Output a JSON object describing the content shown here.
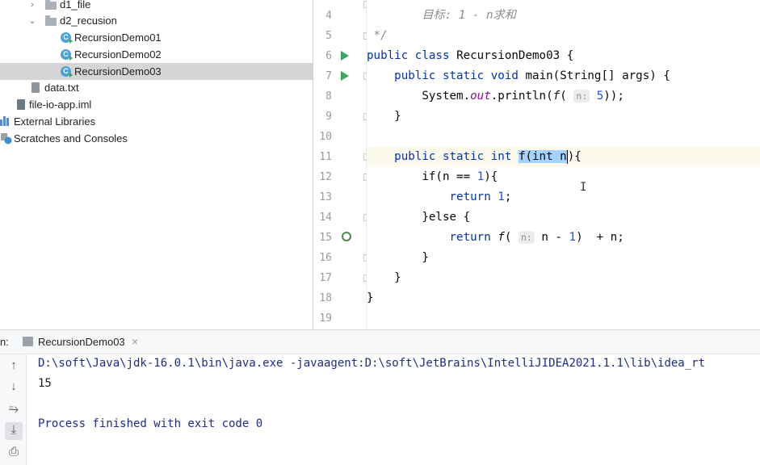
{
  "project_tree": {
    "items": [
      {
        "label": "d1_file",
        "kind": "folder",
        "expanded": false
      },
      {
        "label": "d2_recusion",
        "kind": "folder",
        "expanded": true
      },
      {
        "label": "RecursionDemo01",
        "kind": "class"
      },
      {
        "label": "RecursionDemo02",
        "kind": "class"
      },
      {
        "label": "RecursionDemo03",
        "kind": "class",
        "selected": true
      },
      {
        "label": "data.txt",
        "kind": "file"
      },
      {
        "label": "file-io-app.iml",
        "kind": "file"
      },
      {
        "label": "External Libraries",
        "kind": "libraries"
      },
      {
        "label": "Scratches and Consoles",
        "kind": "scratches"
      }
    ]
  },
  "editor": {
    "line_numbers": [
      "4",
      "5",
      "6",
      "7",
      "8",
      "9",
      "10",
      "11",
      "12",
      "13",
      "14",
      "15",
      "16",
      "17",
      "18",
      "19"
    ],
    "comment_goal": "目标: 1 - n求和",
    "comment_end": "*/",
    "kw_public": "public",
    "kw_class": "class",
    "class_name": "RecursionDemo03",
    "brace_open": "{",
    "brace_close": "}",
    "kw_static": "static",
    "kw_void": "void",
    "main_decl": "main(String[] args)",
    "system_out": "System.",
    "out_field": "out",
    "println": ".println(",
    "call_f": "f",
    "paren_open": "(",
    "param_hint": "n:",
    "arg_five": "5",
    "call_end": "));",
    "kw_int": "int",
    "sel_text": "f(int n",
    "decl_end": "){",
    "if_open": "if(n == ",
    "one": "1",
    "if_close": "){",
    "kw_return": "return",
    "semicolon": ";",
    "else_text": "}else {",
    "n_minus": "n - ",
    "plus_n": ")  + n;"
  },
  "run_panel": {
    "prefix": "n:",
    "tab_label": "RecursionDemo03",
    "close_symbol": "×",
    "command": "D:\\soft\\Java\\jdk-16.0.1\\bin\\java.exe -javaagent:D:\\soft\\JetBrains\\IntelliJIDEA2021.1.1\\lib\\idea_rt",
    "result": "15",
    "finished": "Process finished with exit code 0"
  },
  "colors": {
    "keyword": "#0033b3",
    "comment": "#8c8c8c",
    "number": "#1750eb",
    "static_field": "#871094",
    "selection": "#a6d2ff",
    "console_text": "#1d2b8a"
  }
}
